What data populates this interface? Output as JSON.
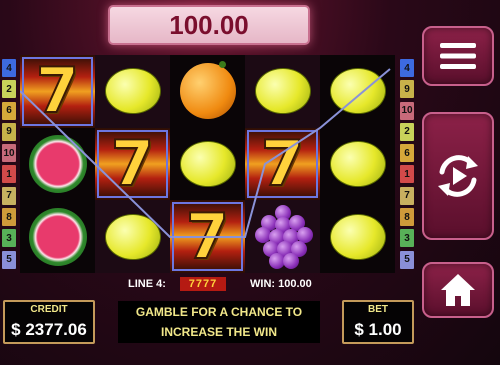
{
  "win_display": {
    "amount": "100.00"
  },
  "paylines": {
    "left": [
      {
        "num": "4",
        "color": "#3d6ae0"
      },
      {
        "num": "2",
        "color": "#c8d25a"
      },
      {
        "num": "6",
        "color": "#d6a83a"
      },
      {
        "num": "9",
        "color": "#c8b24a"
      },
      {
        "num": "10",
        "color": "#c86a7a"
      },
      {
        "num": "1",
        "color": "#d24a4a"
      },
      {
        "num": "7",
        "color": "#c8b060"
      },
      {
        "num": "8",
        "color": "#cf9a3a"
      },
      {
        "num": "3",
        "color": "#58b058"
      },
      {
        "num": "5",
        "color": "#8a8fd8"
      }
    ],
    "right": [
      {
        "num": "4",
        "color": "#3d6ae0"
      },
      {
        "num": "9",
        "color": "#c8b24a"
      },
      {
        "num": "10",
        "color": "#c86a7a"
      },
      {
        "num": "2",
        "color": "#c8d25a"
      },
      {
        "num": "6",
        "color": "#d6a83a"
      },
      {
        "num": "1",
        "color": "#d24a4a"
      },
      {
        "num": "7",
        "color": "#c8b060"
      },
      {
        "num": "8",
        "color": "#cf9a3a"
      },
      {
        "num": "3",
        "color": "#58b058"
      },
      {
        "num": "5",
        "color": "#8a8fd8"
      }
    ]
  },
  "reels": [
    [
      "seven",
      "watermelon",
      "watermelon"
    ],
    [
      "lemon",
      "seven",
      "lemon"
    ],
    [
      "orange",
      "lemon",
      "seven"
    ],
    [
      "lemon",
      "seven",
      "grapes"
    ],
    [
      "lemon",
      "lemon",
      "lemon"
    ]
  ],
  "win_line": {
    "label": "LINE 4:",
    "symbols": "7777",
    "win_label": "WIN: 100.00",
    "highlighted": [
      [
        0,
        0
      ],
      [
        1,
        1
      ],
      [
        2,
        2
      ],
      [
        3,
        1
      ]
    ]
  },
  "credit": {
    "label": "CREDIT",
    "value": "$ 2377.06"
  },
  "message": {
    "line1": "GAMBLE FOR A CHANCE TO",
    "line2": "INCREASE THE WIN"
  },
  "bet": {
    "label": "BET",
    "value": "$ 1.00"
  },
  "buttons": {
    "menu": "menu-icon",
    "spin": "autoplay-spin-icon",
    "home": "home-icon"
  },
  "symbol_seven": "7"
}
